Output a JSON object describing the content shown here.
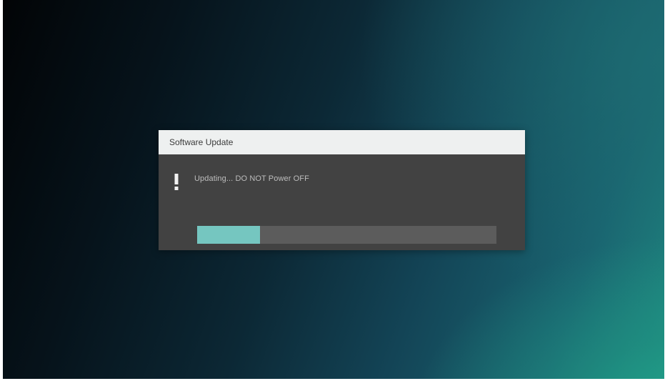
{
  "dialog": {
    "title": "Software Update",
    "icon": "exclamation-icon",
    "message": "Updating... DO NOT Power OFF",
    "progress": 0.21
  },
  "colors": {
    "dialog_header": "#eef0f0",
    "dialog_body": "#424242",
    "progress_track": "#5c5c5c",
    "progress_fill": "#75c6c0"
  }
}
